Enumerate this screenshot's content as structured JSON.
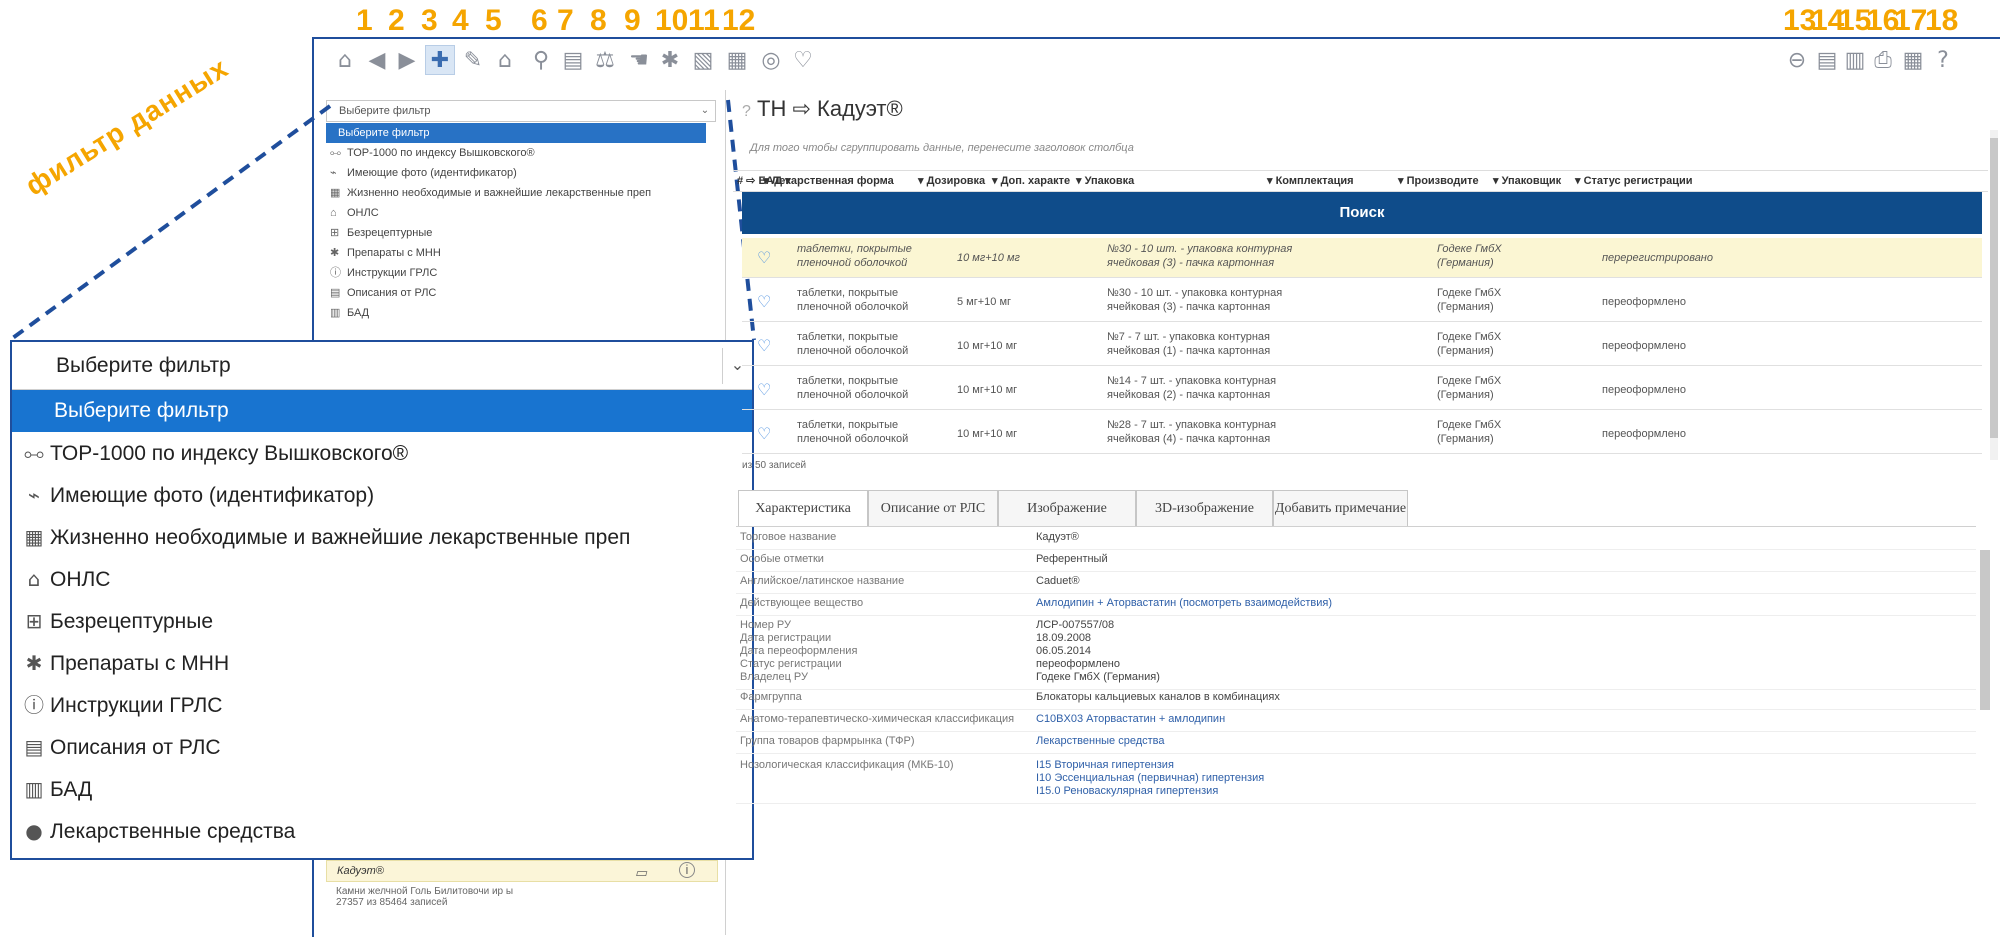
{
  "callout_numbers": [
    "1",
    "2",
    "3",
    "4",
    "5",
    "6",
    "7",
    "8",
    "9",
    "10",
    "11",
    "12",
    "13",
    "14",
    "15",
    "16",
    "17",
    "18"
  ],
  "toolbar": {
    "left_icons": [
      "home-icon",
      "back-icon",
      "forward-icon",
      "pills-icon",
      "chat-icon",
      "pharmacy-icon",
      "search-tool-icon",
      "barcode-icon",
      "scales-icon",
      "hand-icon",
      "network-icon",
      "document-icon",
      "cash-register-icon",
      "disc-icon",
      "heart-icon"
    ],
    "right_icons": [
      "minus-circle-icon",
      "report-icon",
      "report-edit-icon",
      "print-icon",
      "calculator-icon",
      "help-icon"
    ]
  },
  "annotation": {
    "label": "фильтр данных",
    "color": "#f5a500"
  },
  "small_filter": {
    "selected": "Выберите фильтр",
    "items": [
      {
        "label": "Выберите фильтр",
        "icon": ""
      },
      {
        "label": "ТОР-1000 по индексу Вышковского®",
        "icon": "⧟"
      },
      {
        "label": "Имеющие фото (идентификатор)",
        "icon": "⌁"
      },
      {
        "label": "Жизненно необходимые и важнейшие лекарственные преп",
        "icon": "▦"
      },
      {
        "label": "ОНЛС",
        "icon": "⌂"
      },
      {
        "label": "Безрецептурные",
        "icon": "⊞"
      },
      {
        "label": "Препараты с МНН",
        "icon": "✱"
      },
      {
        "label": "Инструкции ГРЛС",
        "icon": "ⓘ"
      },
      {
        "label": "Описания от РЛС",
        "icon": "▤"
      },
      {
        "label": "БАД",
        "icon": "▥"
      }
    ]
  },
  "big_filter": {
    "selected": "Выберите фильтр",
    "items": [
      {
        "label": "Выберите фильтр",
        "icon": ""
      },
      {
        "label": "ТОР-1000 по индексу Вышковского®",
        "icon": "⧟"
      },
      {
        "label": "Имеющие фото (идентификатор)",
        "icon": "⌁"
      },
      {
        "label": "Жизненно необходимые и важнейшие лекарственные преп",
        "icon": "▦"
      },
      {
        "label": "ОНЛС",
        "icon": "⌂"
      },
      {
        "label": "Безрецептурные",
        "icon": "⊞"
      },
      {
        "label": "Препараты с МНН",
        "icon": "✱"
      },
      {
        "label": "Инструкции ГРЛС",
        "icon": "ⓘ"
      },
      {
        "label": "Описания от РЛС",
        "icon": "▤"
      },
      {
        "label": "БАД",
        "icon": "▥"
      },
      {
        "label": "Лекарственные средства",
        "icon": "●"
      }
    ]
  },
  "sidebar_bottom": {
    "selected_item": "Кадуэт®",
    "note": "Камни желчной Голь Билитовочи ир ы",
    "count": "27357 из 85464 записей"
  },
  "breadcrumb": {
    "help": "?",
    "section": "ТН",
    "arrow": "⇨",
    "name": "Кадуэт®"
  },
  "group_hint": "Для того чтобы сгруппировать данные, перенесите заголовок столбца",
  "table": {
    "headers": [
      "Лекарственная форма",
      "Дозировка",
      "Доп. характе",
      "Упаковка",
      "Комплектация",
      "Производите",
      "Упаковщик",
      "Статус регистрации"
    ],
    "search_label": "Поиск",
    "rows": [
      {
        "form": [
          "таблетки, покрытые",
          "пленочной оболочкой"
        ],
        "dose": "10 мг+10 мг",
        "pack": [
          "№30 - 10 шт. - упаковка контурная",
          "ячейковая (3) - пачка картонная"
        ],
        "maker": [
          "Годеке ГмбХ",
          "(Германия)"
        ],
        "status": "перерегистрировано",
        "highlight": true
      },
      {
        "form": [
          "таблетки, покрытые",
          "пленочной оболочкой"
        ],
        "dose": "5 мг+10 мг",
        "pack": [
          "№30 - 10 шт. - упаковка контурная",
          "ячейковая (3) - пачка картонная"
        ],
        "maker": [
          "Годеке ГмбХ",
          "(Германия)"
        ],
        "status": "переоформлено",
        "highlight": false
      },
      {
        "form": [
          "таблетки, покрытые",
          "пленочной оболочкой"
        ],
        "dose": "10 мг+10 мг",
        "pack": [
          "№7 - 7 шт. - упаковка контурная",
          "ячейковая (1) - пачка картонная"
        ],
        "maker": [
          "Годеке ГмбХ",
          "(Германия)"
        ],
        "status": "переоформлено",
        "highlight": false
      },
      {
        "form": [
          "таблетки, покрытые",
          "пленочной оболочкой"
        ],
        "dose": "10 мг+10 мг",
        "pack": [
          "№14 - 7 шт. - упаковка контурная",
          "ячейковая (2) - пачка картонная"
        ],
        "maker": [
          "Годеке ГмбХ",
          "(Германия)"
        ],
        "status": "переоформлено",
        "highlight": false
      },
      {
        "form": [
          "таблетки, покрытые",
          "пленочной оболочкой"
        ],
        "dose": "10 мг+10 мг",
        "pack": [
          "№28 - 7 шт. - упаковка контурная",
          "ячейковая (4) - пачка картонная"
        ],
        "maker": [
          "Годеке ГмбХ",
          "(Германия)"
        ],
        "status": "переоформлено",
        "highlight": false
      }
    ],
    "pager": "из 50 записей"
  },
  "tabs": [
    "Характеристика",
    "Описание от РЛС",
    "Изображение",
    "3D-изображение",
    "Добавить примечание"
  ],
  "details": [
    {
      "k": [
        "Торговое название"
      ],
      "v": [
        "Кадуэт®"
      ]
    },
    {
      "k": [
        "Особые отметки"
      ],
      "v": [
        "Референтный"
      ]
    },
    {
      "k": [
        "Английское/латинское название"
      ],
      "v": [
        "Caduet®"
      ]
    },
    {
      "k": [
        "Действующее вещество"
      ],
      "v": [
        "Амлодипин + Аторвастатин (посмотреть взаимодействия)"
      ],
      "link": true
    },
    {
      "k": [
        "Номер РУ",
        "Дата регистрации",
        "Дата переоформления",
        "Статус регистрации",
        "Владелец РУ"
      ],
      "v": [
        "ЛСР-007557/08",
        "18.09.2008",
        "06.05.2014",
        "переоформлено",
        "Годеке ГмбХ (Германия)"
      ]
    },
    {
      "k": [
        "Фармгруппа"
      ],
      "v": [
        "Блокаторы кальциевых каналов в комбинациях"
      ]
    },
    {
      "k": [
        "Анатомо-терапевтическо-химическая классификация"
      ],
      "v": [
        "C10BX03 Аторвастатин + амлодипин"
      ],
      "link": true
    },
    {
      "k": [
        "Группа товаров фармрынка (ТФР)"
      ],
      "v": [
        "Лекарственные средства"
      ],
      "link": true
    },
    {
      "k": [
        "Нозологическая классификация (МКБ-10)"
      ],
      "v": [
        "I15 Вторичная гипертензия",
        "I10 Эссенциальная (первичная) гипертензия",
        "I15.0 Реноваскулярная гипертензия"
      ],
      "link": true
    }
  ]
}
